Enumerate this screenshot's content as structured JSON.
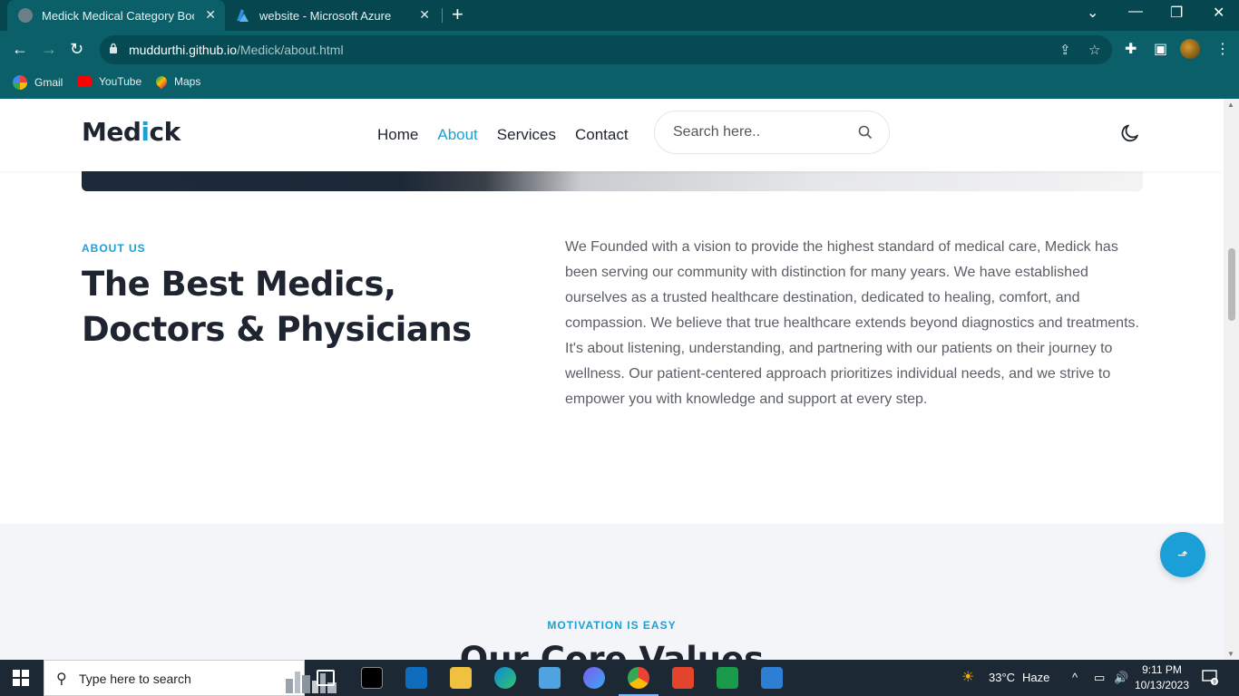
{
  "browser": {
    "tabs": [
      {
        "title": "Medick Medical Category Bootst",
        "active": true
      },
      {
        "title": "website - Microsoft Azure",
        "active": false
      }
    ],
    "url_host": "muddurthi.github.io",
    "url_path": "/Medick/about.html",
    "bookmarks": [
      {
        "label": "Gmail"
      },
      {
        "label": "YouTube"
      },
      {
        "label": "Maps"
      }
    ]
  },
  "site": {
    "logo_main": "Med",
    "logo_accent": "i",
    "logo_end": "ck",
    "nav": [
      {
        "label": "Home",
        "active": false
      },
      {
        "label": "About",
        "active": true
      },
      {
        "label": "Services",
        "active": false
      },
      {
        "label": "Contact",
        "active": false
      }
    ],
    "search_placeholder": "Search here.."
  },
  "about": {
    "label": "ABOUT US",
    "title": "The Best Medics, Doctors & Physicians",
    "text": "We Founded with a vision to provide the highest standard of medical care, Medick has been serving our community with distinction for many years. We have established ourselves as a trusted healthcare destination, dedicated to healing, comfort, and compassion. We believe that true healthcare extends beyond diagnostics and treatments. It's about listening, understanding, and partnering with our patients on their journey to wellness. Our patient-centered approach prioritizes individual needs, and we strive to empower you with knowledge and support at every step."
  },
  "values": {
    "label": "MOTIVATION IS EASY",
    "title": "Our Core Values"
  },
  "taskbar": {
    "search_placeholder": "Type here to search",
    "weather_temp": "33°C",
    "weather_desc": "Haze",
    "time": "9:11 PM",
    "date": "10/13/2023",
    "notification_count": "9"
  },
  "colors": {
    "accent": "#1aa0d6",
    "chrome_dark": "#06464f",
    "chrome": "#0b5f69",
    "heading": "#1e2430"
  }
}
